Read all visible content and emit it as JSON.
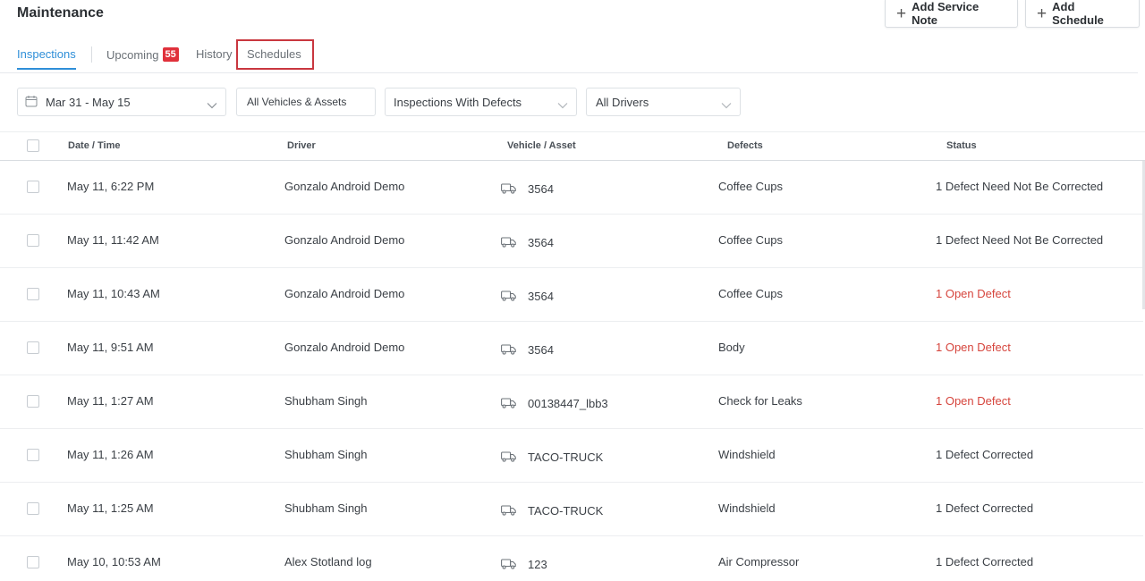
{
  "page": {
    "title": "Maintenance",
    "add_service_note": "Add Service Note",
    "add_schedule": "Add Schedule"
  },
  "tabs": {
    "inspections": "Inspections",
    "upcoming": "Upcoming",
    "upcoming_count": "55",
    "history": "History",
    "schedules": "Schedules",
    "active": "Inspections"
  },
  "filters": {
    "date_range": "Mar 31 - May 15",
    "vehicles": "All Vehicles & Assets",
    "defects": "Inspections With Defects",
    "drivers": "All Drivers"
  },
  "table": {
    "columns": [
      "Date / Time",
      "Driver",
      "Vehicle / Asset",
      "Defects",
      "Status"
    ],
    "rows": [
      {
        "date": "May 11, 6:22 PM",
        "driver": "Gonzalo Android Demo",
        "vehicle": "3564",
        "defect": "Coffee Cups",
        "status": "1 Defect Need Not Be Corrected",
        "status_type": "normal"
      },
      {
        "date": "May 11, 11:42 AM",
        "driver": "Gonzalo Android Demo",
        "vehicle": "3564",
        "defect": "Coffee Cups",
        "status": "1 Defect Need Not Be Corrected",
        "status_type": "normal"
      },
      {
        "date": "May 11, 10:43 AM",
        "driver": "Gonzalo Android Demo",
        "vehicle": "3564",
        "defect": "Coffee Cups",
        "status": "1 Open Defect",
        "status_type": "open"
      },
      {
        "date": "May 11, 9:51 AM",
        "driver": "Gonzalo Android Demo",
        "vehicle": "3564",
        "defect": "Body",
        "status": "1 Open Defect",
        "status_type": "open"
      },
      {
        "date": "May 11, 1:27 AM",
        "driver": "Shubham Singh",
        "vehicle": "00138447_lbb3",
        "defect": "Check for Leaks",
        "status": "1 Open Defect",
        "status_type": "open"
      },
      {
        "date": "May 11, 1:26 AM",
        "driver": "Shubham Singh",
        "vehicle": "TACO-TRUCK",
        "defect": "Windshield",
        "status": "1 Defect Corrected",
        "status_type": "normal"
      },
      {
        "date": "May 11, 1:25 AM",
        "driver": "Shubham Singh",
        "vehicle": "TACO-TRUCK",
        "defect": "Windshield",
        "status": "1 Defect Corrected",
        "status_type": "normal"
      },
      {
        "date": "May 10, 10:53 AM",
        "driver": "Alex Stotland log",
        "vehicle": "123",
        "defect": "Air Compressor",
        "status": "1 Defect Corrected",
        "status_type": "normal"
      }
    ]
  },
  "colors": {
    "accent": "#2f8fd8",
    "badge": "#e0313b",
    "open_defect": "#d6453d",
    "highlight": "#c9373f"
  },
  "icons": {
    "date_filter": "calendar-icon",
    "dropdown": "chevron-down-icon",
    "vehicle": "truck-icon",
    "add": "plus-icon"
  }
}
